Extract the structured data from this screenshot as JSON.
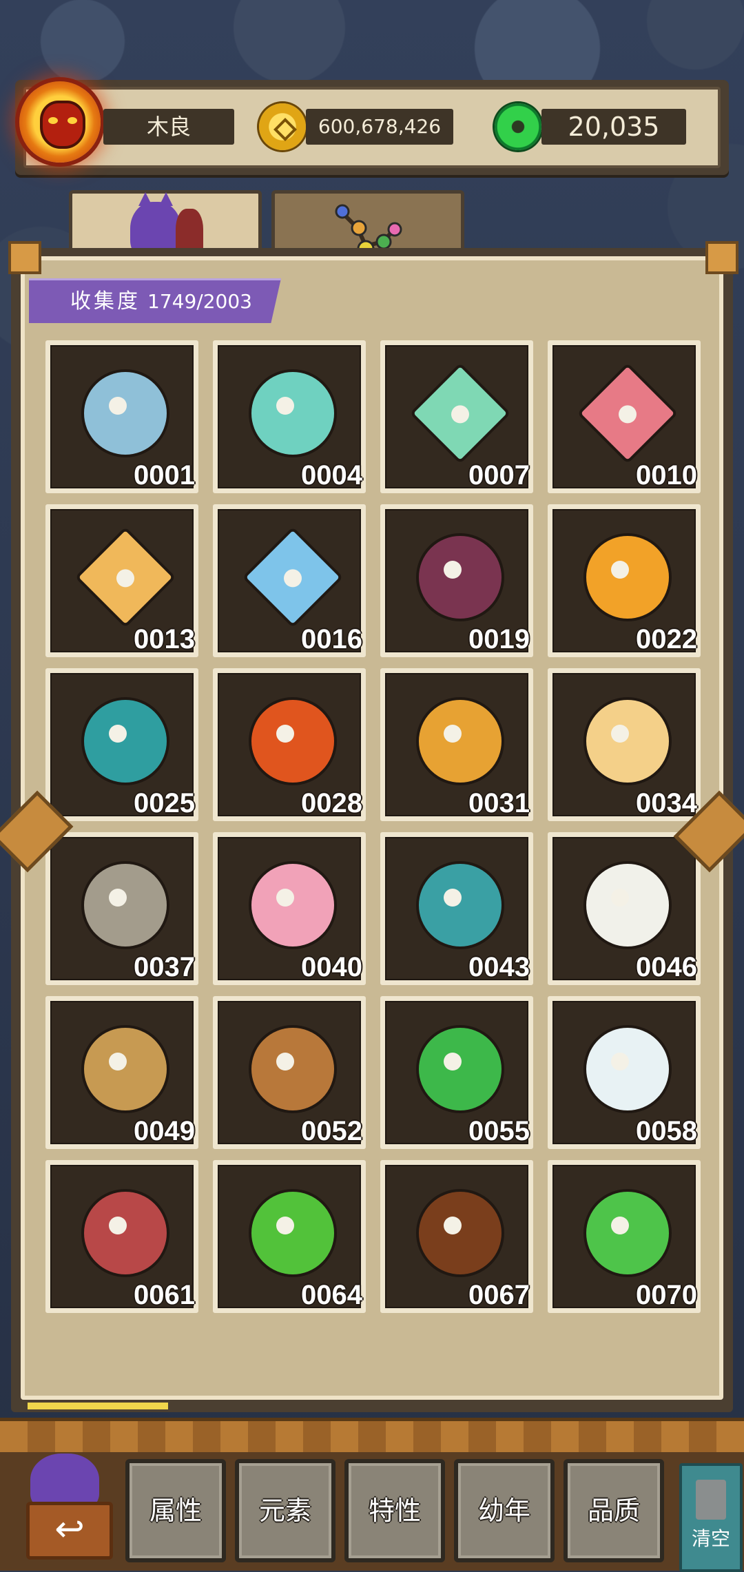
{
  "header": {
    "player_name": "木良",
    "gold": "600,678,426",
    "jade": "20,035"
  },
  "tabs": [
    {
      "name": "monster-codex",
      "selected": true
    },
    {
      "name": "evolution-tree",
      "selected": false
    }
  ],
  "collection": {
    "label": "收集度",
    "value": "1749/2003"
  },
  "monsters": [
    {
      "id": "0001",
      "icon": "blue-fish-creature",
      "color": "#8fc0d8"
    },
    {
      "id": "0004",
      "icon": "teal-scroll-creature",
      "color": "#6fd1c0"
    },
    {
      "id": "0007",
      "icon": "mint-diamond-spirit",
      "color": "#7fd8b4"
    },
    {
      "id": "0010",
      "icon": "pink-diamond-spirit",
      "color": "#e77a86"
    },
    {
      "id": "0013",
      "icon": "amber-diamond-spirit",
      "color": "#f0b85a"
    },
    {
      "id": "0016",
      "icon": "blue-diamond-spirit",
      "color": "#7ec4ea"
    },
    {
      "id": "0019",
      "icon": "purple-chestnut",
      "color": "#7a3450"
    },
    {
      "id": "0022",
      "icon": "orange-chick",
      "color": "#f2a228"
    },
    {
      "id": "0025",
      "icon": "teal-ghost",
      "color": "#2f9ea0"
    },
    {
      "id": "0028",
      "icon": "fox-in-box",
      "color": "#e0551e"
    },
    {
      "id": "0031",
      "icon": "orange-seed",
      "color": "#e7a233"
    },
    {
      "id": "0034",
      "icon": "spotted-chick",
      "color": "#f4d089"
    },
    {
      "id": "0037",
      "icon": "stone-monkey",
      "color": "#a39c8c"
    },
    {
      "id": "0040",
      "icon": "pink-bulb-sprout",
      "color": "#f1a2b8"
    },
    {
      "id": "0043",
      "icon": "heart-ghost",
      "color": "#3aa0a4"
    },
    {
      "id": "0046",
      "icon": "feather-pot",
      "color": "#f1f1ea"
    },
    {
      "id": "0049",
      "icon": "sprout-potato",
      "color": "#c79a52"
    },
    {
      "id": "0052",
      "icon": "chestnut-cake",
      "color": "#b8783a"
    },
    {
      "id": "0055",
      "icon": "green-snake",
      "color": "#3db84a"
    },
    {
      "id": "0058",
      "icon": "white-ghost",
      "color": "#e8f2f4"
    },
    {
      "id": "0061",
      "icon": "red-bean-sprout",
      "color": "#b84848"
    },
    {
      "id": "0064",
      "icon": "green-swirl-bird",
      "color": "#52c23a"
    },
    {
      "id": "0067",
      "icon": "acorn-kid",
      "color": "#7a3e1c"
    },
    {
      "id": "0070",
      "icon": "green-slime",
      "color": "#4ec44a"
    }
  ],
  "filters": [
    {
      "label": "属性"
    },
    {
      "label": "元素"
    },
    {
      "label": "特性"
    },
    {
      "label": "幼年"
    },
    {
      "label": "品质"
    }
  ],
  "clear_label": "清空",
  "back_icon": "back-arrow-icon"
}
